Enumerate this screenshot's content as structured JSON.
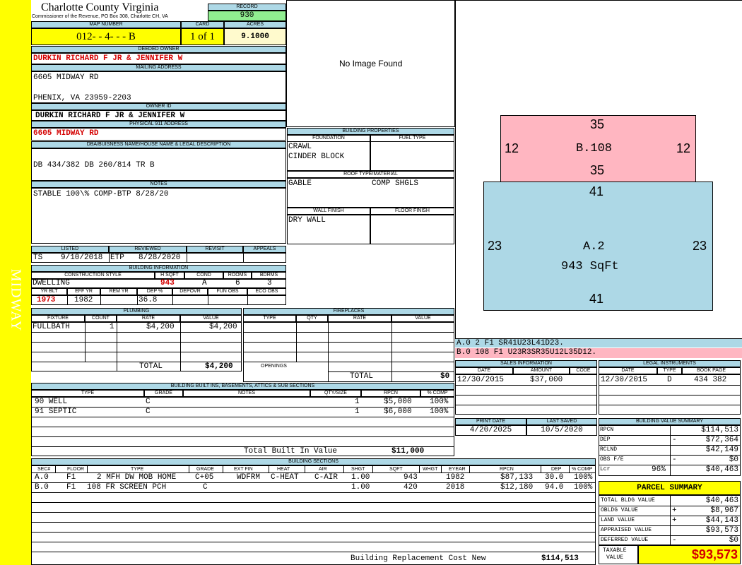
{
  "sidebar": {
    "road": "MIDWAY"
  },
  "header": {
    "county": "Charlotte County Virginia",
    "commissioner": "Commissioner of the Revenue, PO Box 308, Charlotte CH, VA",
    "record_label": "RECORD",
    "record": "930",
    "map_label": "MAP NUMBER",
    "map_number": "012-  - 4-  -  -  B",
    "card_label": "CARD",
    "card": "1 of 1",
    "acres_label": "ACRES",
    "acres": "9.1000"
  },
  "owner": {
    "deeded_label": "DEEDED OWNER",
    "deeded": "DURKIN RICHARD F JR & JENNIFER W",
    "mailing_label": "MAILING ADDRESS",
    "address1": "6605 MIDWAY RD",
    "address2": "PHENIX, VA 23959-2203",
    "id_label": "OWNER ID",
    "owner_id": "DURKIN RICHARD F JR & JENNIFER W",
    "physical_label": "PHYSICAL 911 ADDRESS",
    "physical": "6605 MIDWAY RD",
    "dba_label": "DBA/BUISNESS NAME/HOUSE NAME & LEGAL DESCRIPTION",
    "legal": "DB 434/382 DB 260/814 TR B",
    "notes_label": "NOTES",
    "notes": "STABLE 100\\% COMP-BTP 8/28/20"
  },
  "photo": {
    "text": "No Image Found"
  },
  "building_props": {
    "title": "BUILDING PROPERTIES",
    "foundation_label": "FOUNDATION",
    "fuel_label": "FUEL TYPE",
    "foundation1": "CRAWL",
    "foundation2": "CINDER BLOCK",
    "roof_label": "ROOF TYPE/MATERIAL",
    "roof_type": "GABLE",
    "roof_material": "COMP SHGLS",
    "wall_label": "WALL FINISH",
    "floor_label": "FLOOR FINISH",
    "wall": "DRY WALL"
  },
  "sketch": {
    "b_top": "35",
    "b_left": "12",
    "b_label": "B.108",
    "b_right": "12",
    "b_bottom": "35",
    "a_top": "41",
    "a_left": "23",
    "a_label": "A.2",
    "a_area": "943 SqFt",
    "a_right": "23",
    "a_bottom": "41",
    "legend_a": "A.0  2   F1  SR41U23L41D23.",
    "legend_b": "B.0  108  F1  U23R3SR35U12L35D12."
  },
  "listing": {
    "listed_label": "LISTED",
    "reviewed_label": "REVIEWED",
    "revisit_label": "REVISIT",
    "appeals_label": "APPEALS",
    "listed_by": "TS",
    "listed_date": "9/10/2018",
    "reviewed_by": "ETP",
    "reviewed_date": "8/28/2020"
  },
  "building_info": {
    "title": "BUILDING INFORMATION",
    "h_style": "CONSTRUCTION STYLE",
    "h_hsqft": "H SQFT",
    "h_cond": "COND",
    "h_rooms": "ROOMS",
    "h_bdrms": "BDRMS",
    "style": "DWELLING",
    "hsqft": "943",
    "cond": "A",
    "rooms": "6",
    "bdrms": "3",
    "h_yrblt": "YR BLT",
    "h_effyr": "EFF YR",
    "h_remyr": "REM YR",
    "h_dep": "DEP %",
    "h_depovr": "DEPOVR",
    "h_funobs": "FUN OBS",
    "h_ecoobs": "ECO OBS",
    "yrblt": "1973",
    "effyr": "1982",
    "dep": "36.8"
  },
  "plumbing": {
    "title": "PLUMBING",
    "h_fixture": "FIXTURE",
    "h_count": "COUNT",
    "h_rate": "RATE",
    "h_value": "VALUE",
    "fixture": "FULLBATH",
    "count": "1",
    "rate": "$4,200",
    "value": "$4,200",
    "total_label": "TOTAL",
    "total": "$4,200"
  },
  "fireplaces": {
    "title": "FIREPLACES",
    "h_type": "TYPE",
    "h_qty": "QTY",
    "h_rate": "RATE",
    "h_value": "VALUE",
    "openings_label": "OPENINGS",
    "total_label": "TOTAL",
    "total": "$0"
  },
  "builtins": {
    "title": "BUILDING BUILT INS, BASEMENTS, ATTICS & SUB SECTIONS",
    "h_type": "TYPE",
    "h_grade": "GRADE",
    "h_notes": "NOTES",
    "h_qty": "QTY/SIZE",
    "h_rpcn": "RPCN",
    "h_comp": "% COMP",
    "rows": [
      {
        "type": "90 WELL",
        "grade": "C",
        "qty": "1",
        "rpcn": "$5,000",
        "comp": "100%"
      },
      {
        "type": "91 SEPTIC",
        "grade": "C",
        "qty": "1",
        "rpcn": "$6,000",
        "comp": "100%"
      }
    ],
    "total_label": "Total Built In Value",
    "total": "$11,000"
  },
  "sales": {
    "title": "SALES INFORMATION",
    "h_date": "DATE",
    "h_amount": "AMOUNT",
    "h_code": "CODE",
    "date": "12/30/2015",
    "amount": "$37,000"
  },
  "legal": {
    "title": "LEGAL INSTRUMENTS",
    "h_date": "DATE",
    "h_type": "TYPE",
    "h_book": "BOOK PAGE",
    "date": "12/30/2015",
    "type": "D",
    "book": "434 382"
  },
  "dates": {
    "print_label": "PRINT DATE",
    "print": "4/20/2025",
    "saved_label": "LAST SAVED",
    "saved": "10/5/2020"
  },
  "value_summary": {
    "title": "BUILDING VALUE SUMMARY",
    "rpcn_label": "RPCN",
    "rpcn": "$114,513",
    "dep_label": "DEP",
    "dep_sign": "-",
    "dep": "$72,364",
    "rclnd_label": "RCLND",
    "rclnd": "$42,149",
    "obs_label": "OBS F/E",
    "obs_sign": "-",
    "obs": "$0",
    "lcr_label": "Lcr",
    "lcr_pct": "96%",
    "lcr": "$40,463"
  },
  "parcel": {
    "title": "PARCEL SUMMARY",
    "bldg_label": "TOTAL BLDG VALUE",
    "bldg": "$40,463",
    "obldg_label": "OBLDG VALUE",
    "obldg_sign": "+",
    "obldg": "$8,967",
    "land_label": "LAND VALUE",
    "land_sign": "+",
    "land": "$44,143",
    "appraised_label": "APPRAISED VALUE",
    "appraised": "$93,573",
    "deferred_label": "DEFERRED VALUE",
    "deferred_sign": "-",
    "deferred": "$0",
    "taxable_label1": "TAXABLE",
    "taxable_label2": "VALUE",
    "taxable": "$93,573"
  },
  "sections": {
    "title": "BUILDING SECTIONS",
    "headers": [
      "SEC#",
      "FLOOR",
      "TYPE",
      "GRADE",
      "EXT FIN",
      "HEAT",
      "AIR",
      "SHGT",
      "SQFT",
      "WHGT",
      "EYEAR",
      "RPCN",
      "DEP",
      "% COMP"
    ],
    "rows": [
      {
        "sec": "A.0",
        "floor": "F1",
        "type": "2 MFH DW MOB HOME",
        "grade": "C+05",
        "ext": "WDFRM",
        "heat": "C-HEAT",
        "air": "C-AIR",
        "shgt": "1.00",
        "sqft": "943",
        "whgt": "",
        "eyear": "1982",
        "rpcn": "$87,133",
        "dep": "30.0",
        "comp": "100%"
      },
      {
        "sec": "B.0",
        "floor": "F1",
        "type": "108 FR SCREEN PCH",
        "grade": "C",
        "ext": "",
        "heat": "",
        "air": "",
        "shgt": "1.00",
        "sqft": "420",
        "whgt": "",
        "eyear": "2018",
        "rpcn": "$12,180",
        "dep": "94.0",
        "comp": "100%"
      }
    ],
    "replacement_label": "Building Replacement Cost New",
    "replacement": "$114,513"
  }
}
